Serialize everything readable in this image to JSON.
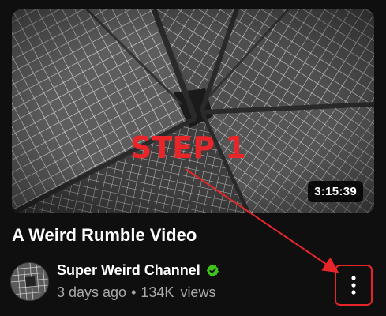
{
  "video": {
    "duration": "3:15:39",
    "title": "A Weird Rumble Video",
    "channel": {
      "name": "Super Weird Channel",
      "verified": true,
      "verified_color": "#3ec41c"
    },
    "uploaded": "3 days ago",
    "separator": "•",
    "views_count": "134K",
    "views_label": "views"
  },
  "annotation": {
    "label": "STEP 1",
    "color": "#e8262a"
  },
  "icons": {
    "more": "more-vertical-icon",
    "verified": "verified-check-icon"
  }
}
